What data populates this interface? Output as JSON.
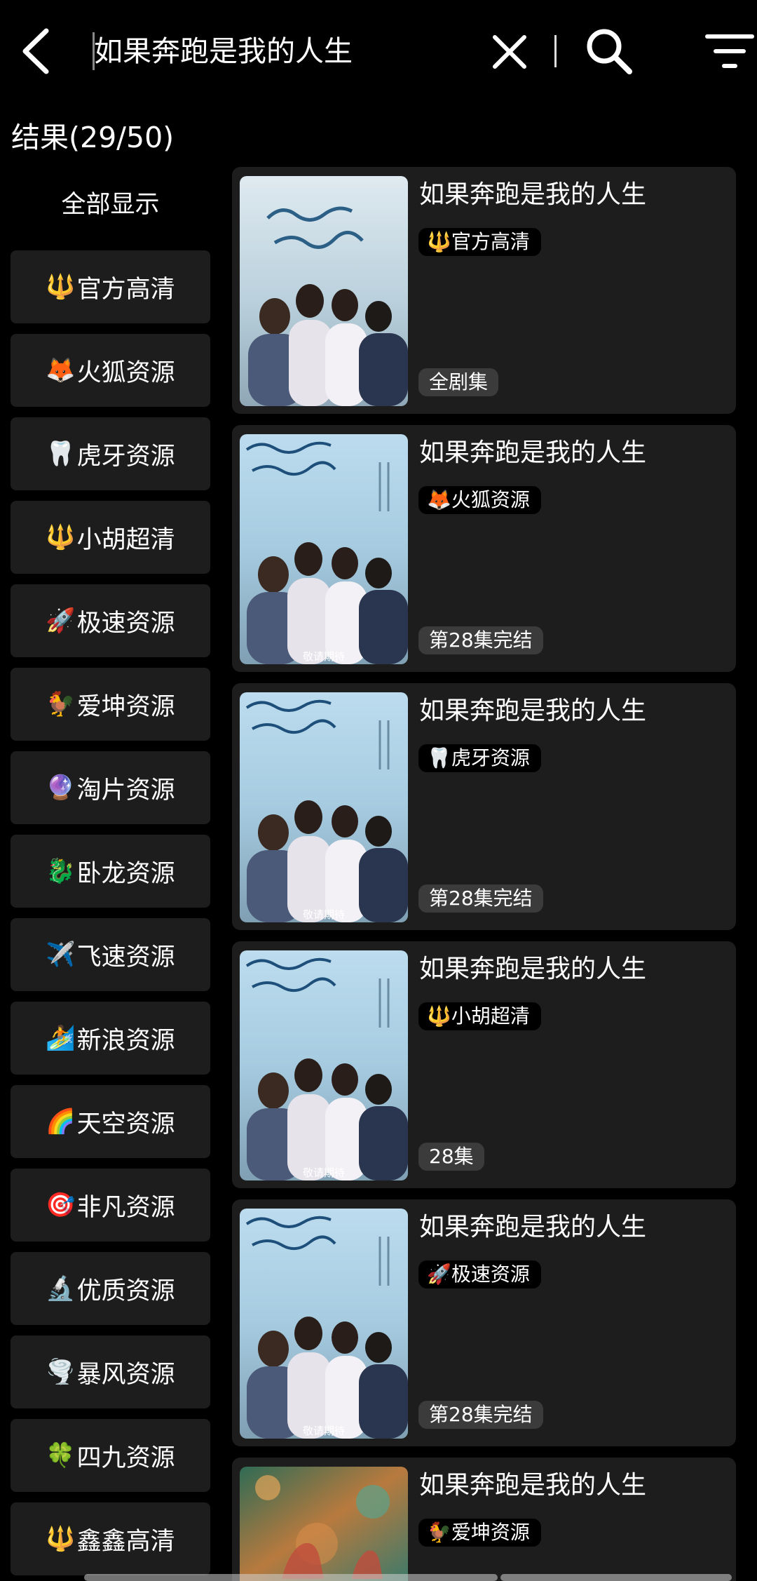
{
  "search": {
    "query": "如果奔跑是我的人生",
    "results_label": "结果(29/50)"
  },
  "icons": {
    "back": "chevron-left-icon",
    "clear": "close-icon",
    "search": "search-icon",
    "filter": "filter-icon"
  },
  "sidebar": {
    "show_all": "全部显示",
    "items": [
      {
        "emoji": "🔱",
        "label": "官方高清"
      },
      {
        "emoji": "🦊",
        "label": "火狐资源"
      },
      {
        "emoji": "🦷",
        "label": "虎牙资源"
      },
      {
        "emoji": "🔱",
        "label": "小胡超清"
      },
      {
        "emoji": "🚀",
        "label": "极速资源"
      },
      {
        "emoji": "🐓",
        "label": "爱坤资源"
      },
      {
        "emoji": "🔮",
        "label": "淘片资源"
      },
      {
        "emoji": "🐉",
        "label": "卧龙资源"
      },
      {
        "emoji": "✈️",
        "label": "飞速资源"
      },
      {
        "emoji": "🏄",
        "label": "新浪资源"
      },
      {
        "emoji": "🌈",
        "label": "天空资源"
      },
      {
        "emoji": "🎯",
        "label": "非凡资源"
      },
      {
        "emoji": "🔬",
        "label": "优质资源"
      },
      {
        "emoji": "🌪️",
        "label": "暴风资源"
      },
      {
        "emoji": "🍀",
        "label": "四九资源"
      },
      {
        "emoji": "🔱",
        "label": "鑫鑫高清"
      }
    ]
  },
  "results": [
    {
      "title": "如果奔跑是我的人生",
      "source": "🔱官方高清",
      "episodes": "全剧集",
      "poster_caption": ""
    },
    {
      "title": "如果奔跑是我的人生",
      "source": "🦊火狐资源",
      "episodes": "第28集完结",
      "poster_caption": "敬请期待"
    },
    {
      "title": "如果奔跑是我的人生",
      "source": "🦷虎牙资源",
      "episodes": "第28集完结",
      "poster_caption": "敬请期待"
    },
    {
      "title": "如果奔跑是我的人生",
      "source": "🔱小胡超清",
      "episodes": "28集",
      "poster_caption": "敬请期待"
    },
    {
      "title": "如果奔跑是我的人生",
      "source": "🚀极速资源",
      "episodes": "第28集完结",
      "poster_caption": "敬请期待"
    },
    {
      "title": "如果奔跑是我的人生",
      "source": "🐓爱坤资源",
      "episodes": "",
      "poster_caption": ""
    }
  ],
  "colors": {
    "background": "#000000",
    "panel": "#1d1d1d",
    "episode_badge": "#3b3b3b",
    "text": "#ffffff"
  }
}
